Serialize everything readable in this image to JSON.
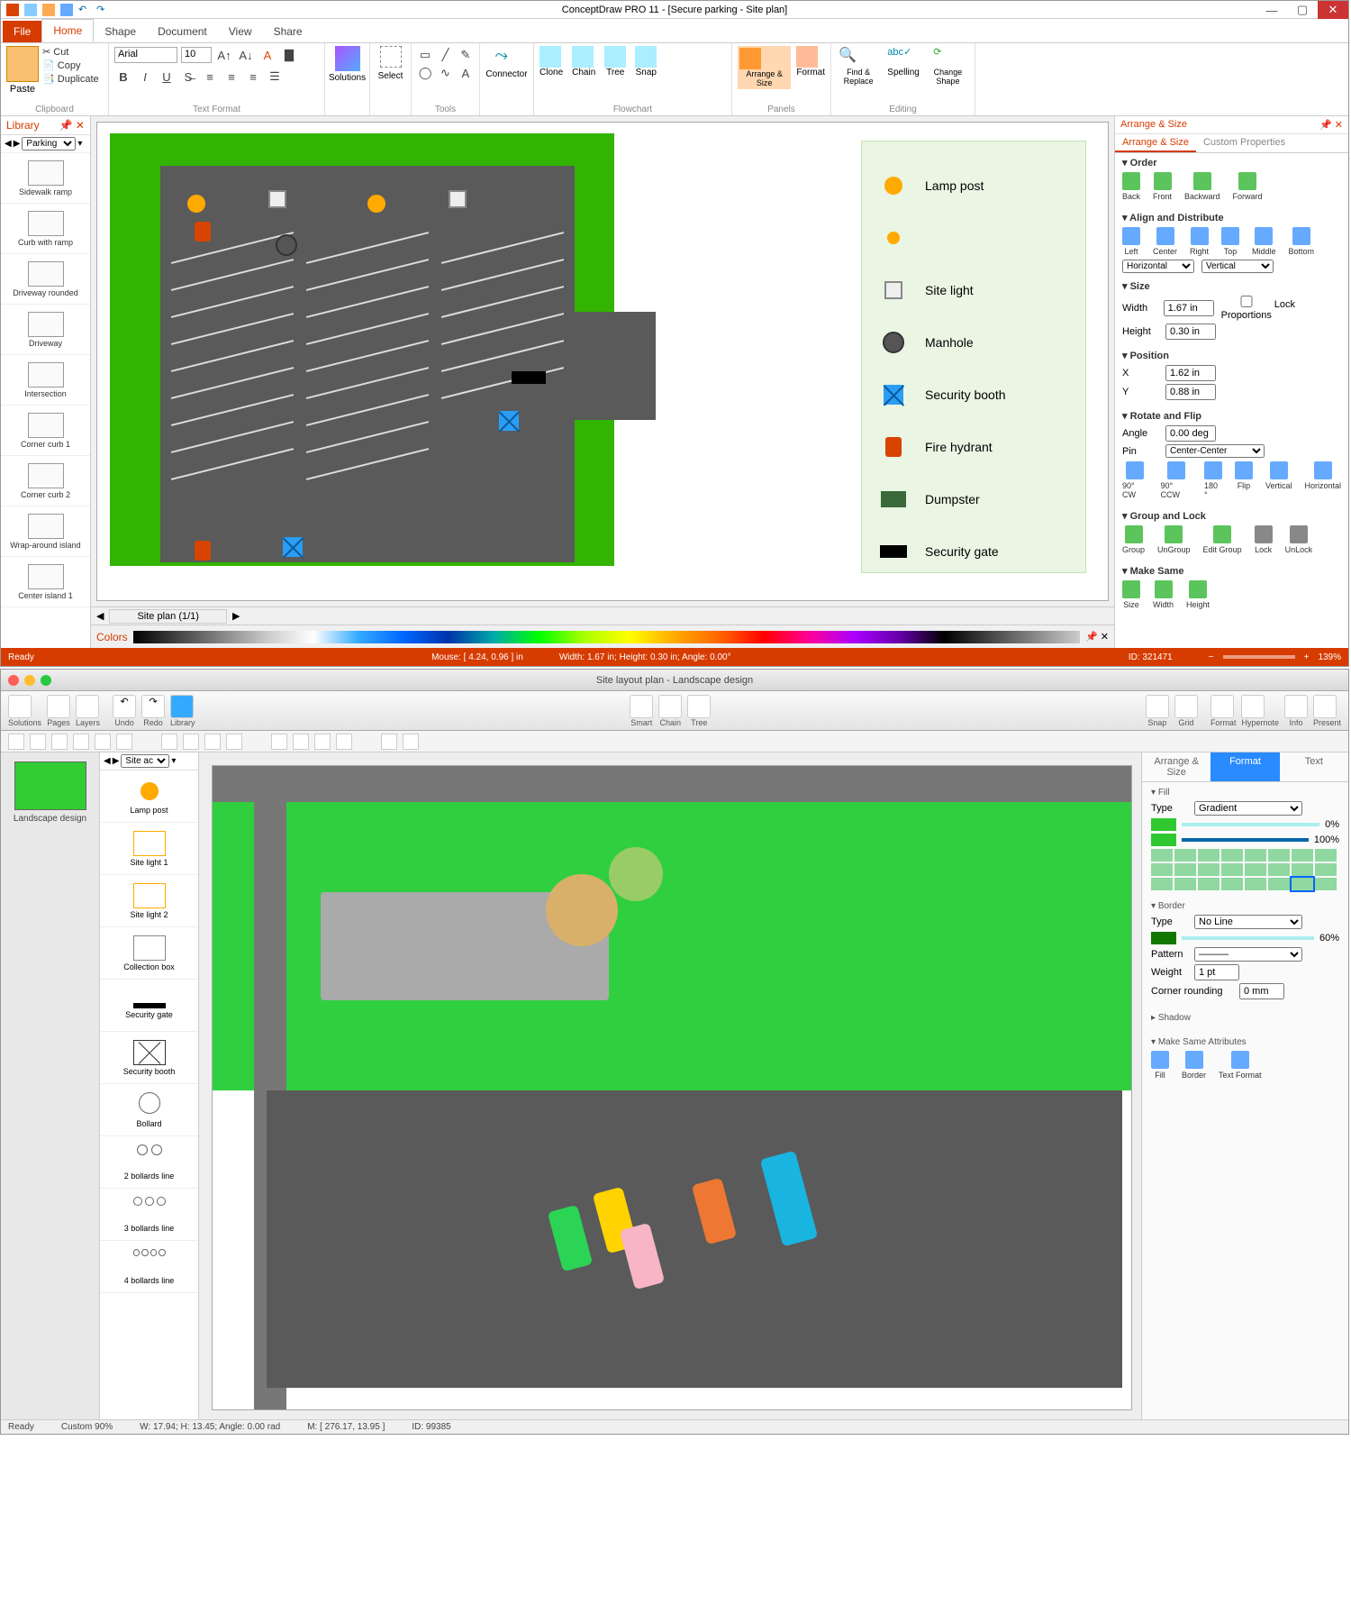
{
  "topApp": {
    "title": "ConceptDraw PRO 11 - [Secure parking - Site plan]",
    "tabs": {
      "file": "File",
      "home": "Home",
      "shape": "Shape",
      "document": "Document",
      "view": "View",
      "share": "Share"
    },
    "clipboard": {
      "paste": "Paste",
      "cut": "Cut",
      "copy": "Copy",
      "duplicate": "Duplicate",
      "label": "Clipboard"
    },
    "font": {
      "name": "Arial",
      "size": "10",
      "label": "Text Format"
    },
    "solutions": "Solutions",
    "select": "Select",
    "tools": "Tools",
    "connector": "Connector",
    "clone": "Clone",
    "chain": "Chain",
    "tree": "Tree",
    "snap": "Snap",
    "flowchart": "Flowchart",
    "arrangeSize": "Arrange & Size",
    "format": "Format",
    "panels": "Panels",
    "findReplace": "Find & Replace",
    "spelling": "Spelling",
    "changeShape": "Change Shape",
    "editing": "Editing",
    "library": {
      "title": "Library",
      "selector": "Parking ...",
      "items": [
        "Sidewalk ramp",
        "Curb with ramp",
        "Driveway rounded",
        "Driveway",
        "Intersection",
        "Corner curb 1",
        "Corner curb 2",
        "Wrap-around island",
        "Center island 1"
      ]
    },
    "legend": {
      "lamp": "Lamp post",
      "sitelight": "Site light",
      "manhole": "Manhole",
      "booth": "Security booth",
      "hydrant": "Fire hydrant",
      "dumpster": "Dumpster",
      "gate": "Security gate"
    },
    "pageTab": "Site plan (1/1)",
    "colorsLabel": "Colors",
    "rpanel": {
      "title": "Arrange & Size",
      "tab1": "Arrange & Size",
      "tab2": "Custom Properties",
      "order": {
        "h": "Order",
        "back": "Back",
        "front": "Front",
        "backward": "Backward",
        "forward": "Forward"
      },
      "align": {
        "h": "Align and Distribute",
        "left": "Left",
        "center": "Center",
        "right": "Right",
        "top": "Top",
        "middle": "Middle",
        "bottom": "Bottom",
        "horiz": "Horizontal",
        "vert": "Vertical"
      },
      "size": {
        "h": "Size",
        "w": "Width",
        "wV": "1.67 in",
        "he": "Height",
        "hV": "0.30 in",
        "lock": "Lock Proportions"
      },
      "pos": {
        "h": "Position",
        "x": "X",
        "xV": "1.62 in",
        "y": "Y",
        "yV": "0.88 in"
      },
      "rot": {
        "h": "Rotate and Flip",
        "ang": "Angle",
        "angV": "0.00 deg",
        "pin": "Pin",
        "pinV": "Center-Center",
        "cw": "90° CW",
        "ccw": "90° CCW",
        "r180": "180 °",
        "flip": "Flip",
        "vert": "Vertical",
        "horiz": "Horizontal"
      },
      "group": {
        "h": "Group and Lock",
        "g": "Group",
        "ug": "UnGroup",
        "eg": "Edit Group",
        "lk": "Lock",
        "ulk": "UnLock"
      },
      "same": {
        "h": "Make Same",
        "sz": "Size",
        "w": "Width",
        "he": "Height"
      }
    },
    "status": {
      "ready": "Ready",
      "mouse": "Mouse: [ 4.24, 0.96 ] in",
      "dims": "Width: 1.67 in;  Height: 0.30 in;  Angle: 0.00°",
      "id": "ID: 321471",
      "zoom": "139%"
    }
  },
  "botApp": {
    "title": "Site layout plan - Landscape design",
    "tool": {
      "solutions": "Solutions",
      "pages": "Pages",
      "layers": "Layers",
      "undo": "Undo",
      "redo": "Redo",
      "library": "Library",
      "smart": "Smart",
      "chain": "Chain",
      "tree": "Tree",
      "snap": "Snap",
      "grid": "Grid",
      "format": "Format",
      "hypernote": "Hypernote",
      "info": "Info",
      "present": "Present"
    },
    "thumbLabel": "Landscape design",
    "lib": {
      "selector": "Site ac...",
      "items": [
        "Lamp post",
        "Site light 1",
        "Site light 2",
        "Collection box",
        "Security gate",
        "Security booth",
        "Bollard",
        "2 bollards line",
        "3 bollards line",
        "4 bollards line"
      ]
    },
    "right": {
      "tab1": "Arrange & Size",
      "tab2": "Format",
      "tab3": "Text",
      "fill": "Fill",
      "type": "Type",
      "gradient": "Gradient",
      "p0": "0%",
      "p100": "100%",
      "border": "Border",
      "noline": "No Line",
      "op": "60%",
      "pattern": "Pattern",
      "weight": "Weight",
      "weightV": "1 pt",
      "corner": "Corner rounding",
      "cornerV": "0 mm",
      "shadow": "Shadow",
      "msa": "Make Same Attributes",
      "mfill": "Fill",
      "mborder": "Border",
      "mtxt": "Text Format"
    },
    "status": {
      "ready": "Ready",
      "zoom": "Custom 90%",
      "wh": "W: 17.94;  H: 13.45;  Angle: 0.00 rad",
      "m": "M: [ 276.17, 13.95 ]",
      "id": "ID: 99385"
    }
  }
}
